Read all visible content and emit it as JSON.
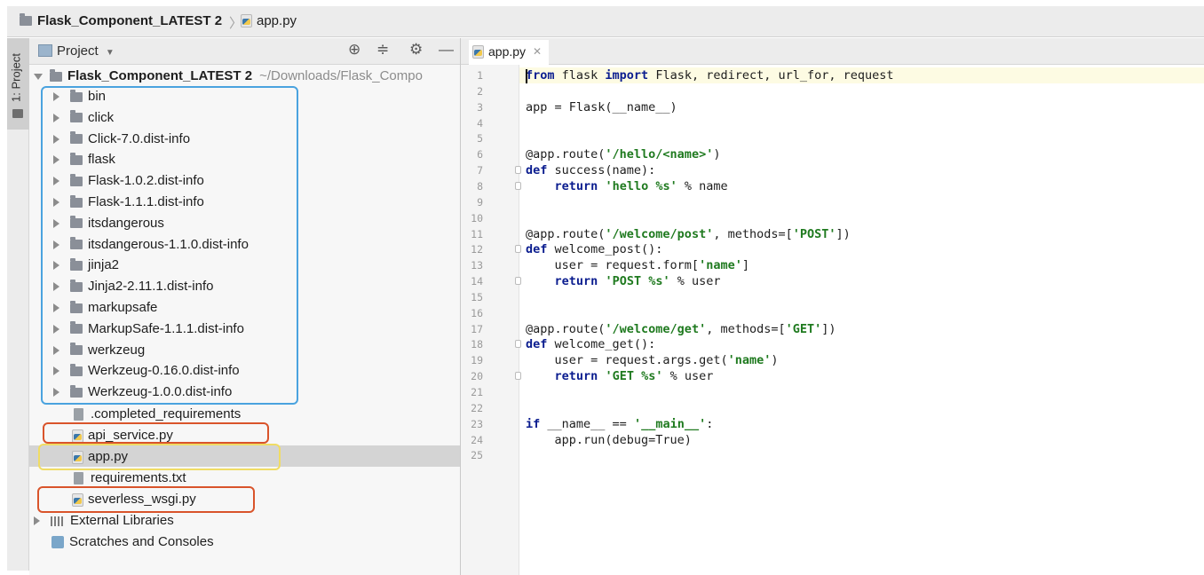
{
  "breadcrumb": {
    "project": "Flask_Component_LATEST 2",
    "file": "app.py"
  },
  "toolstrip": {
    "project_tab": "1: Project"
  },
  "project_panel": {
    "title": "Project",
    "root": {
      "name": "Flask_Component_LATEST 2",
      "path": "~/Downloads/Flask_Compo"
    },
    "folders": [
      "bin",
      "click",
      "Click-7.0.dist-info",
      "flask",
      "Flask-1.0.2.dist-info",
      "Flask-1.1.1.dist-info",
      "itsdangerous",
      "itsdangerous-1.1.0.dist-info",
      "jinja2",
      "Jinja2-2.11.1.dist-info",
      "markupsafe",
      "MarkupSafe-1.1.1.dist-info",
      "werkzeug",
      "Werkzeug-0.16.0.dist-info",
      "Werkzeug-1.0.0.dist-info"
    ],
    "files": [
      {
        "name": ".completed_requirements",
        "kind": "text"
      },
      {
        "name": "api_service.py",
        "kind": "python"
      },
      {
        "name": "app.py",
        "kind": "python"
      },
      {
        "name": "requirements.txt",
        "kind": "text"
      },
      {
        "name": "severless_wsgi.py",
        "kind": "python"
      }
    ],
    "external_libraries": "External Libraries",
    "scratches": "Scratches and Consoles",
    "selected_file": "app.py"
  },
  "highlight_colors": {
    "folders": "#4aa3df",
    "api_service": "#d9542b",
    "app": "#f0dc64",
    "serverless": "#d9542b"
  },
  "editor": {
    "tab_label": "app.py",
    "line_numbers": [
      "1",
      "2",
      "3",
      "4",
      "5",
      "6",
      "7",
      "8",
      "9",
      "10",
      "11",
      "12",
      "13",
      "14",
      "15",
      "16",
      "17",
      "18",
      "19",
      "20",
      "21",
      "22",
      "23",
      "24",
      "25"
    ],
    "lines": [
      [
        {
          "t": "from",
          "c": "kw"
        },
        {
          "t": " flask ",
          "c": ""
        },
        {
          "t": "import",
          "c": "kw"
        },
        {
          "t": " Flask, redirect, url_for, request",
          "c": ""
        }
      ],
      [],
      [
        {
          "t": "app = Flask(__name__)",
          "c": ""
        }
      ],
      [],
      [],
      [
        {
          "t": "@app.route(",
          "c": ""
        },
        {
          "t": "'/hello/<name>'",
          "c": "str"
        },
        {
          "t": ")",
          "c": ""
        }
      ],
      [
        {
          "t": "def",
          "c": "kw"
        },
        {
          "t": " success(name):",
          "c": ""
        }
      ],
      [
        {
          "t": "    ",
          "c": ""
        },
        {
          "t": "return",
          "c": "kw"
        },
        {
          "t": " ",
          "c": ""
        },
        {
          "t": "'hello %s'",
          "c": "str"
        },
        {
          "t": " % name",
          "c": ""
        }
      ],
      [],
      [],
      [
        {
          "t": "@app.route(",
          "c": ""
        },
        {
          "t": "'/welcome/post'",
          "c": "str"
        },
        {
          "t": ", methods=[",
          "c": ""
        },
        {
          "t": "'POST'",
          "c": "str"
        },
        {
          "t": "])",
          "c": ""
        }
      ],
      [
        {
          "t": "def",
          "c": "kw"
        },
        {
          "t": " welcome_post():",
          "c": ""
        }
      ],
      [
        {
          "t": "    user = request.form[",
          "c": ""
        },
        {
          "t": "'name'",
          "c": "str"
        },
        {
          "t": "]",
          "c": ""
        }
      ],
      [
        {
          "t": "    ",
          "c": ""
        },
        {
          "t": "return",
          "c": "kw"
        },
        {
          "t": " ",
          "c": ""
        },
        {
          "t": "'POST %s'",
          "c": "str"
        },
        {
          "t": " % user",
          "c": ""
        }
      ],
      [],
      [],
      [
        {
          "t": "@app.route(",
          "c": ""
        },
        {
          "t": "'/welcome/get'",
          "c": "str"
        },
        {
          "t": ", methods=[",
          "c": ""
        },
        {
          "t": "'GET'",
          "c": "str"
        },
        {
          "t": "])",
          "c": ""
        }
      ],
      [
        {
          "t": "def",
          "c": "kw"
        },
        {
          "t": " welcome_get():",
          "c": ""
        }
      ],
      [
        {
          "t": "    user = request.args.get(",
          "c": ""
        },
        {
          "t": "'name'",
          "c": "str"
        },
        {
          "t": ")",
          "c": ""
        }
      ],
      [
        {
          "t": "    ",
          "c": ""
        },
        {
          "t": "return",
          "c": "kw"
        },
        {
          "t": " ",
          "c": ""
        },
        {
          "t": "'GET %s'",
          "c": "str"
        },
        {
          "t": " % user",
          "c": ""
        }
      ],
      [],
      [],
      [
        {
          "t": "if",
          "c": "kw"
        },
        {
          "t": " __name__ == ",
          "c": ""
        },
        {
          "t": "'__main__'",
          "c": "str"
        },
        {
          "t": ":",
          "c": ""
        }
      ],
      [
        {
          "t": "    app.run(debug=True)",
          "c": ""
        }
      ],
      []
    ]
  }
}
